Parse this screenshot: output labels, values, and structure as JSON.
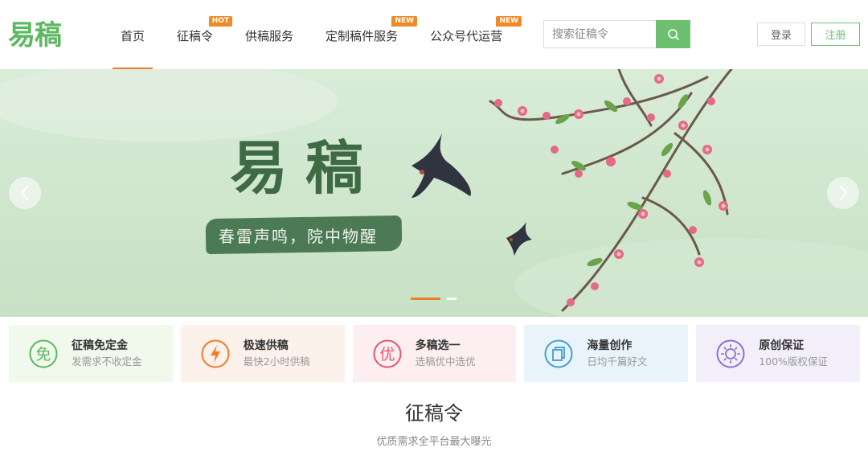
{
  "header": {
    "logo": "易稿",
    "nav": [
      {
        "label": "首页",
        "badge": "",
        "active": true
      },
      {
        "label": "征稿令",
        "badge": "HOT",
        "active": false
      },
      {
        "label": "供稿服务",
        "badge": "",
        "active": false
      },
      {
        "label": "定制稿件服务",
        "badge": "NEW",
        "active": false
      },
      {
        "label": "公众号代运营",
        "badge": "NEW",
        "active": false
      }
    ],
    "search": {
      "placeholder": "搜索征稿令",
      "icon": "search-icon"
    },
    "login": "登录",
    "register": "注册"
  },
  "banner": {
    "title": "易稿",
    "slogan": "春雷声鸣，院中物醒",
    "prev_icon": "chevron-left-icon",
    "next_icon": "chevron-right-icon",
    "slides": 2,
    "active_slide": 1
  },
  "features": [
    {
      "icon": "free-icon",
      "glyph": "免",
      "title": "征稿免定金",
      "sub": "发需求不收定金",
      "color": "#5cb860",
      "bg": "#f1f8ec"
    },
    {
      "icon": "lightning-icon",
      "glyph": "",
      "title": "极速供稿",
      "sub": "最快2小时供稿",
      "color": "#f07c2a",
      "bg": "#fdf1eb"
    },
    {
      "icon": "best-icon",
      "glyph": "优",
      "title": "多稿选一",
      "sub": "选稿优中选优",
      "color": "#e8546a",
      "bg": "#fdeff1"
    },
    {
      "icon": "stack-icon",
      "glyph": "",
      "title": "海量创作",
      "sub": "日均千篇好文",
      "color": "#3f9ed6",
      "bg": "#e9f4fa"
    },
    {
      "icon": "badge-icon",
      "glyph": "",
      "title": "原创保证",
      "sub": "100%版权保证",
      "color": "#8a72c9",
      "bg": "#f2effa"
    }
  ],
  "section": {
    "title": "征稿令",
    "subtitle": "优质需求全平台最大曝光"
  },
  "colors": {
    "brand": "#5cb860",
    "accent": "#f07c2a"
  }
}
